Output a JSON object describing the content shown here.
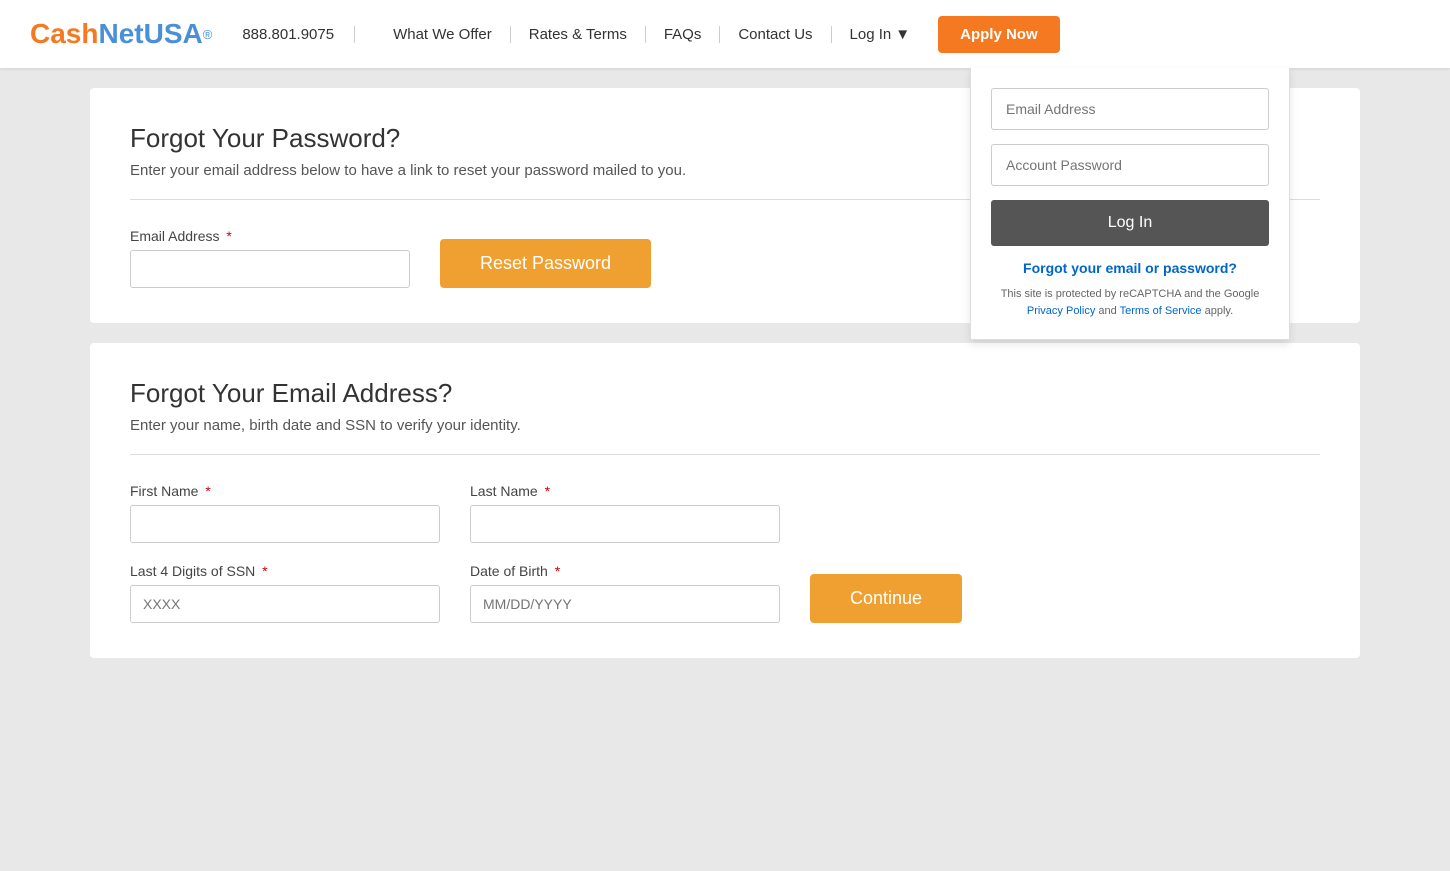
{
  "logo": {
    "cash": "Cash",
    "net": "Net",
    "usa": "USA",
    "reg": "®"
  },
  "header": {
    "phone": "888.801.9075",
    "nav_items": [
      {
        "label": "What We Offer"
      },
      {
        "label": "Rates & Terms"
      },
      {
        "label": "FAQs"
      },
      {
        "label": "Contact Us"
      }
    ],
    "login_label": "Log In",
    "login_chevron": "▼",
    "apply_label": "Apply Now"
  },
  "dropdown": {
    "email_placeholder": "Email Address",
    "password_placeholder": "Account Password",
    "login_btn": "Log In",
    "forgot_link": "Forgot your email or password?",
    "recaptcha_text": "This site is protected by reCAPTCHA and the Google",
    "privacy_link": "Privacy Policy",
    "and_text": " and ",
    "terms_link": "Terms of Service",
    "apply_text": " apply."
  },
  "forgot_password": {
    "title": "Forgot Your Password?",
    "subtitle": "Enter your email address below to have a link to reset your password mailed to you.",
    "email_label": "Email Address",
    "email_placeholder": "",
    "reset_btn": "Reset Password"
  },
  "forgot_email": {
    "title": "Forgot Your Email Address?",
    "subtitle": "Enter your name, birth date and SSN to verify your identity.",
    "first_name_label": "First Name",
    "last_name_label": "Last Name",
    "ssn_label": "Last 4 Digits of SSN",
    "ssn_placeholder": "XXXX",
    "dob_label": "Date of Birth",
    "dob_placeholder": "MM/DD/YYYY",
    "continue_btn": "Continue"
  }
}
